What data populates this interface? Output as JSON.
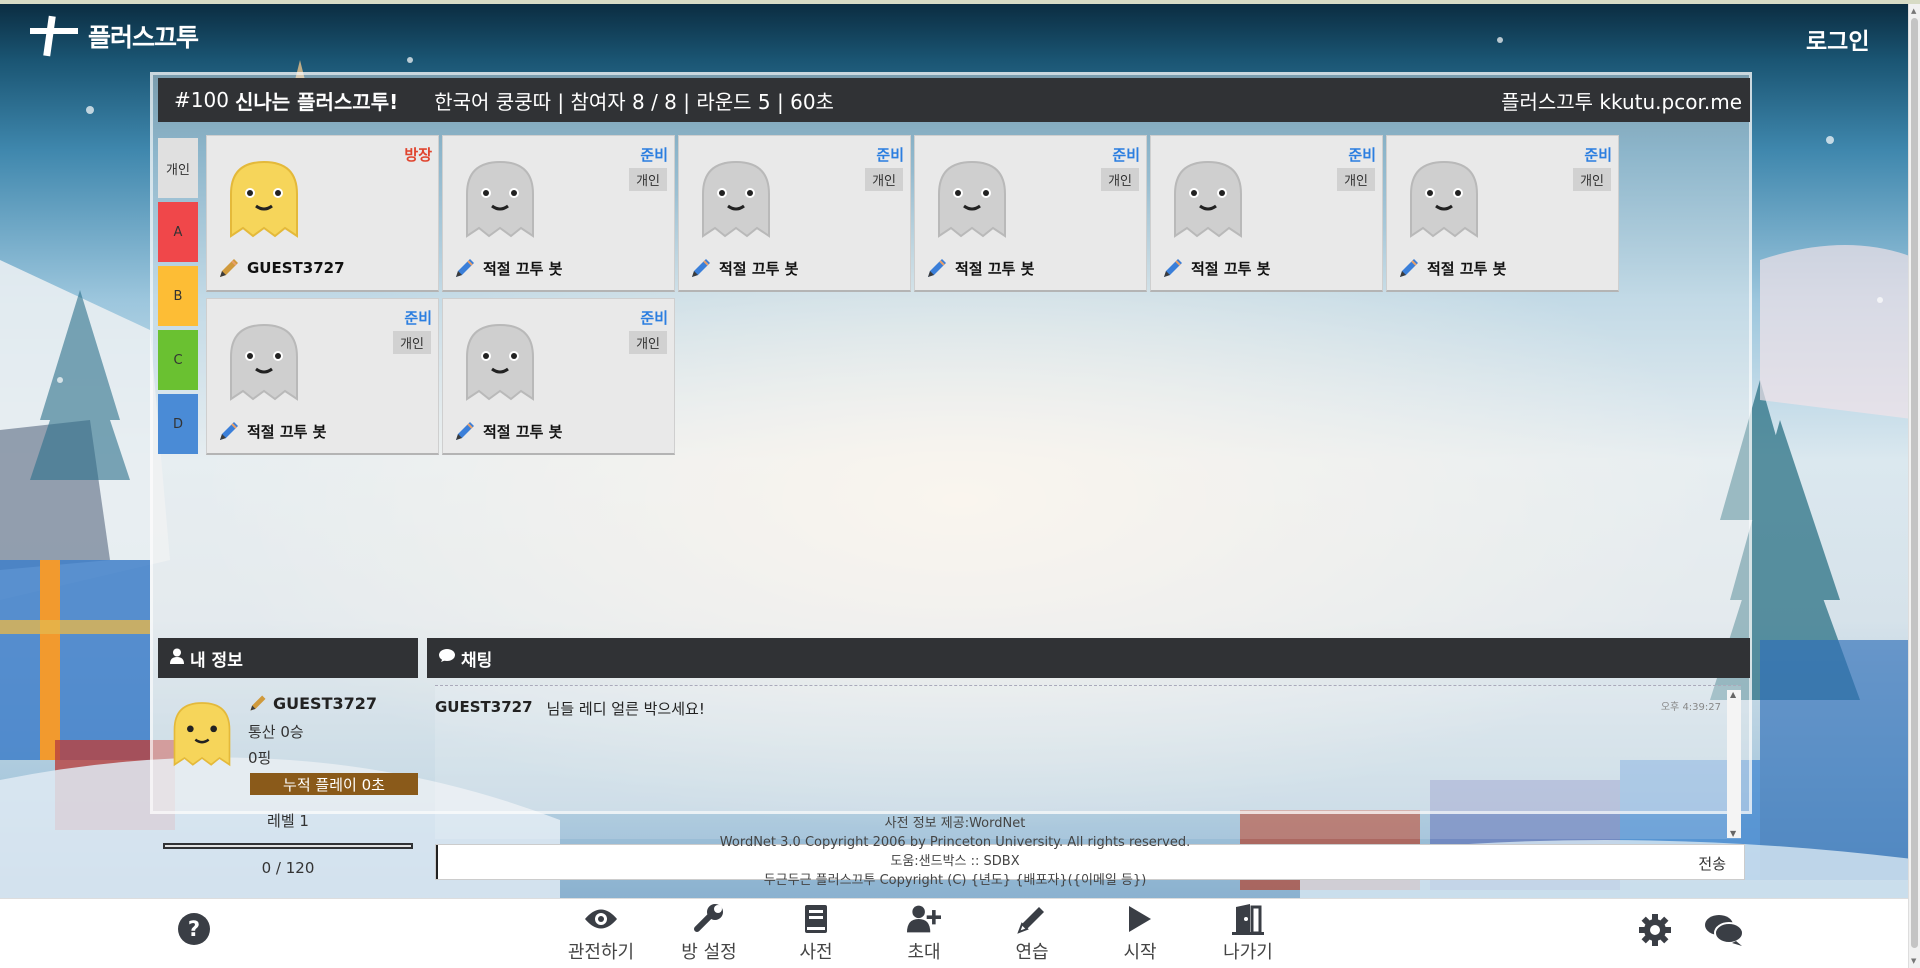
{
  "app": {
    "name": "플러스끄투",
    "login_label": "로그인"
  },
  "room": {
    "number": "#100",
    "title": "신나는 플러스끄투!",
    "info": "한국어 쿵쿵따 |  참여자 8 / 8 |  라운드 5 |  60초",
    "site": "플러스끄투 kkutu.pcor.me"
  },
  "teams": [
    {
      "label": "개인",
      "color": "#e0e0e0"
    },
    {
      "label": "A",
      "color": "#f0474a"
    },
    {
      "label": "B",
      "color": "#fdbd35"
    },
    {
      "label": "C",
      "color": "#6ac131"
    },
    {
      "label": "D",
      "color": "#4a8bd6"
    }
  ],
  "players": [
    {
      "name": "GUEST3727",
      "status": "방장",
      "status_color": "#e0442e",
      "team": "",
      "mascot": "yellow"
    },
    {
      "name": "적절 끄투 봇",
      "status": "준비",
      "status_color": "#2b7ee0",
      "team": "개인",
      "mascot": "gray"
    },
    {
      "name": "적절 끄투 봇",
      "status": "준비",
      "status_color": "#2b7ee0",
      "team": "개인",
      "mascot": "gray"
    },
    {
      "name": "적절 끄투 봇",
      "status": "준비",
      "status_color": "#2b7ee0",
      "team": "개인",
      "mascot": "gray"
    },
    {
      "name": "적절 끄투 봇",
      "status": "준비",
      "status_color": "#2b7ee0",
      "team": "개인",
      "mascot": "gray"
    },
    {
      "name": "적절 끄투 봇",
      "status": "준비",
      "status_color": "#2b7ee0",
      "team": "개인",
      "mascot": "gray"
    },
    {
      "name": "적절 끄투 봇",
      "status": "준비",
      "status_color": "#2b7ee0",
      "team": "개인",
      "mascot": "gray"
    },
    {
      "name": "적절 끄투 봇",
      "status": "준비",
      "status_color": "#2b7ee0",
      "team": "개인",
      "mascot": "gray"
    }
  ],
  "myinfo": {
    "header": "내 정보",
    "name": "GUEST3727",
    "record": "통산 0승",
    "ping": "0핑",
    "playtime": "누적 플레이 0초",
    "level": "레벨 1",
    "exp_text": "0 / 120",
    "exp_fraction": 0
  },
  "chat": {
    "header": "채팅",
    "messages": [
      {
        "sender": "GUEST3727",
        "text": "님들 레디 얼른 박으세요!",
        "time": "오후 4:39:27"
      }
    ],
    "input_value": "",
    "send_label": "전송"
  },
  "footer": [
    "사전 정보 제공:WordNet",
    "WordNet 3.0 Copyright 2006 by Princeton University. All rights reserved.",
    "도움:샌드박스 :: SDBX",
    "두근두근 플러스끄투 Copyright (C) {년도} {배포자}({이메일 등})"
  ],
  "toolbar": [
    {
      "label": "관전하기",
      "icon": "eye-icon"
    },
    {
      "label": "방 설정",
      "icon": "wrench-icon"
    },
    {
      "label": "사전",
      "icon": "book-icon"
    },
    {
      "label": "초대",
      "icon": "user-plus-icon"
    },
    {
      "label": "연습",
      "icon": "pencil-icon"
    },
    {
      "label": "시작",
      "icon": "play-icon"
    },
    {
      "label": "나가기",
      "icon": "door-icon"
    }
  ],
  "help_label": "?"
}
